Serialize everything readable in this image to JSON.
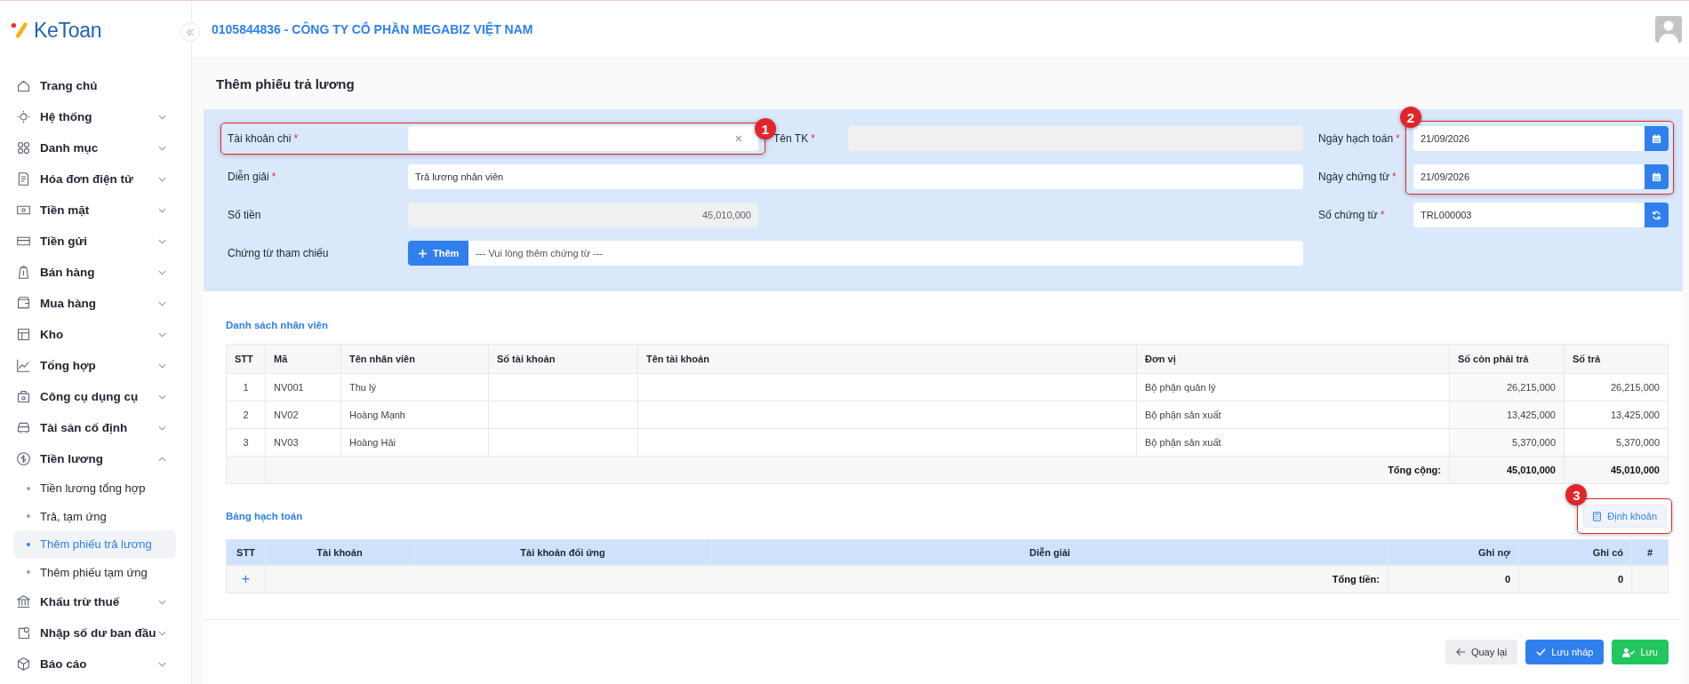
{
  "app": {
    "logo": "KeToan",
    "company": "0105844836 - CÔNG TY CỔ PHẦN MEGABIZ VIỆT NAM"
  },
  "sidebar": {
    "items": [
      {
        "label": "Trang chủ",
        "selected": false
      },
      {
        "label": "Hệ thống",
        "selected": false,
        "expanded": false
      },
      {
        "label": "Danh mục",
        "selected": false,
        "expanded": false
      },
      {
        "label": "Hóa đơn điện tử",
        "selected": false,
        "expanded": false
      },
      {
        "label": "Tiền mặt",
        "selected": false,
        "expanded": false
      },
      {
        "label": "Tiền gửi",
        "selected": false,
        "expanded": false
      },
      {
        "label": "Bán hàng",
        "selected": false,
        "expanded": false
      },
      {
        "label": "Mua hàng",
        "selected": false,
        "expanded": false
      },
      {
        "label": "Kho",
        "selected": false,
        "expanded": false
      },
      {
        "label": "Tổng hợp",
        "selected": false,
        "expanded": false
      },
      {
        "label": "Công cụ dụng cụ",
        "selected": false,
        "expanded": false
      },
      {
        "label": "Tài sản cố định",
        "selected": false,
        "expanded": false
      },
      {
        "label": "Tiền lương",
        "selected": false,
        "expanded": true,
        "children": [
          {
            "label": "Tiền lương tổng hợp",
            "selected": false
          },
          {
            "label": "Trả, tạm ứng",
            "selected": false
          },
          {
            "label": "Thêm phiếu trả lương",
            "selected": true
          },
          {
            "label": "Thêm phiếu tạm ứng",
            "selected": false
          }
        ]
      },
      {
        "label": "Khấu trừ thuế",
        "selected": false,
        "expanded": false
      },
      {
        "label": "Nhập số dư ban đầu",
        "selected": false,
        "expanded": false
      },
      {
        "label": "Báo cáo",
        "selected": false,
        "expanded": false
      }
    ]
  },
  "page_title": "Thêm phiếu trả lương",
  "form": {
    "account": {
      "label": "Tài khoản chi",
      "mark": "*",
      "clear": "×",
      "callout": "1"
    },
    "account_name": {
      "label": "Tên TK",
      "mark": "*",
      "disabled": true
    },
    "description": {
      "label": "Diễn giải",
      "mark": "*",
      "value": "Trả lương nhân viên"
    },
    "amount": {
      "label": "Số tiền",
      "disabled": true,
      "value": "45,010,000"
    },
    "reference": {
      "label": "Chứng từ tham chiếu",
      "button": "Thêm",
      "placeholder": "--- Vui lòng thêm chứng từ ---"
    },
    "right": {
      "callout": "2",
      "fields": [
        {
          "label": "Ngày hạch toán",
          "mark": "*",
          "value": "21/09/2026",
          "kind": "date"
        },
        {
          "label": "Ngày chứng từ",
          "mark": "*",
          "value": "21/09/2026",
          "kind": "date"
        },
        {
          "label": "Số chứng từ",
          "mark": "*",
          "value": "TRL000003",
          "kind": "refresh"
        }
      ]
    }
  },
  "employees": {
    "title": "Danh sách nhân viên",
    "columns": [
      "STT",
      "Mã",
      "Tên nhân viên",
      "Số tài khoản",
      "Tên tài khoản",
      "Đơn vị",
      "Số còn phải trả",
      "Số trả"
    ],
    "rows": [
      [
        "1",
        "NV001",
        "Thu lý",
        "",
        "",
        "Bộ phận quản lý",
        "26,215,000",
        "26,215,000"
      ],
      [
        "2",
        "NV02",
        "Hoàng Mạnh",
        "",
        "",
        "Bộ phận sản xuất",
        "13,425,000",
        "13,425,000"
      ],
      [
        "3",
        "NV03",
        "Hoàng Hải",
        "",
        "",
        "Bộ phận sản xuất",
        "5,370,000",
        "5,370,000"
      ]
    ],
    "total": {
      "label": "Tổng cộng:",
      "values": [
        "45,010,000",
        "45,010,000"
      ]
    }
  },
  "posting": {
    "title": "Bảng hạch toán",
    "button": "Định khoản",
    "callout": "3",
    "columns": [
      "STT",
      "Tài khoản",
      "Tài khoản đối ứng",
      "Diễn giải",
      "Ghi nợ",
      "Ghi có",
      "#"
    ],
    "add": "+",
    "total": {
      "label": "Tổng tiền:",
      "values": [
        "0",
        "0"
      ]
    }
  },
  "footer": {
    "buttons": [
      {
        "label": "Quay lại",
        "kind": "back"
      },
      {
        "label": "Lưu nháp",
        "kind": "draft"
      },
      {
        "label": "Lưu",
        "kind": "save"
      }
    ]
  }
}
